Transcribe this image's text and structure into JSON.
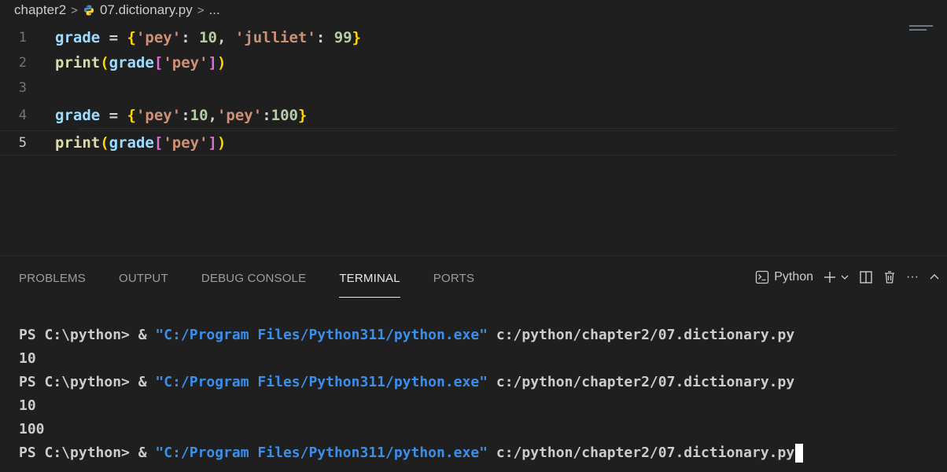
{
  "breadcrumb": {
    "folder": "chapter2",
    "file": "07.dictionary.py",
    "tail": "...",
    "separator": ">"
  },
  "editor": {
    "lines": [
      {
        "num": "1",
        "tokens": [
          {
            "t": "grade",
            "c": "var"
          },
          {
            "t": " = ",
            "c": "op"
          },
          {
            "t": "{",
            "c": "br1"
          },
          {
            "t": "'pey'",
            "c": "str"
          },
          {
            "t": ": ",
            "c": "op"
          },
          {
            "t": "10",
            "c": "num"
          },
          {
            "t": ", ",
            "c": "op"
          },
          {
            "t": "'julliet'",
            "c": "str"
          },
          {
            "t": ": ",
            "c": "op"
          },
          {
            "t": "99",
            "c": "num"
          },
          {
            "t": "}",
            "c": "br1"
          }
        ]
      },
      {
        "num": "2",
        "tokens": [
          {
            "t": "print",
            "c": "fn"
          },
          {
            "t": "(",
            "c": "br1"
          },
          {
            "t": "grade",
            "c": "var"
          },
          {
            "t": "[",
            "c": "br2"
          },
          {
            "t": "'pey'",
            "c": "str"
          },
          {
            "t": "]",
            "c": "br2"
          },
          {
            "t": ")",
            "c": "br1"
          }
        ]
      },
      {
        "num": "3",
        "tokens": []
      },
      {
        "num": "4",
        "tokens": [
          {
            "t": "grade",
            "c": "var"
          },
          {
            "t": " = ",
            "c": "op"
          },
          {
            "t": "{",
            "c": "br1"
          },
          {
            "t": "'pey'",
            "c": "str"
          },
          {
            "t": ":",
            "c": "op"
          },
          {
            "t": "10",
            "c": "num"
          },
          {
            "t": ",",
            "c": "op"
          },
          {
            "t": "'pey'",
            "c": "str"
          },
          {
            "t": ":",
            "c": "op"
          },
          {
            "t": "100",
            "c": "num"
          },
          {
            "t": "}",
            "c": "br1"
          }
        ]
      },
      {
        "num": "5",
        "active": true,
        "tokens": [
          {
            "t": "print",
            "c": "fn"
          },
          {
            "t": "(",
            "c": "br1"
          },
          {
            "t": "grade",
            "c": "var"
          },
          {
            "t": "[",
            "c": "br2"
          },
          {
            "t": "'pey'",
            "c": "str"
          },
          {
            "t": "]",
            "c": "br2"
          },
          {
            "t": ")",
            "c": "br1"
          }
        ]
      }
    ]
  },
  "panel": {
    "tabs": [
      {
        "label": "PROBLEMS"
      },
      {
        "label": "OUTPUT"
      },
      {
        "label": "DEBUG CONSOLE"
      },
      {
        "label": "TERMINAL",
        "active": true
      },
      {
        "label": "PORTS"
      }
    ],
    "terminal_name": "Python",
    "more_label": "···"
  },
  "terminal": {
    "prompt": "PS C:\\python> & ",
    "exe": "\"C:/Program Files/Python311/python.exe\"",
    "script": " c:/python/chapter2/07.dictionary.py",
    "output": [
      {
        "kind": "cmd"
      },
      {
        "kind": "out",
        "text": "10"
      },
      {
        "kind": "cmd"
      },
      {
        "kind": "out",
        "text": "10"
      },
      {
        "kind": "out",
        "text": "100"
      },
      {
        "kind": "cmd",
        "cursor": true
      }
    ]
  },
  "colors": {
    "background": "#1f1f1f",
    "path_blue": "#3b8eea",
    "active_tab_underline": "#e7e7e7"
  }
}
